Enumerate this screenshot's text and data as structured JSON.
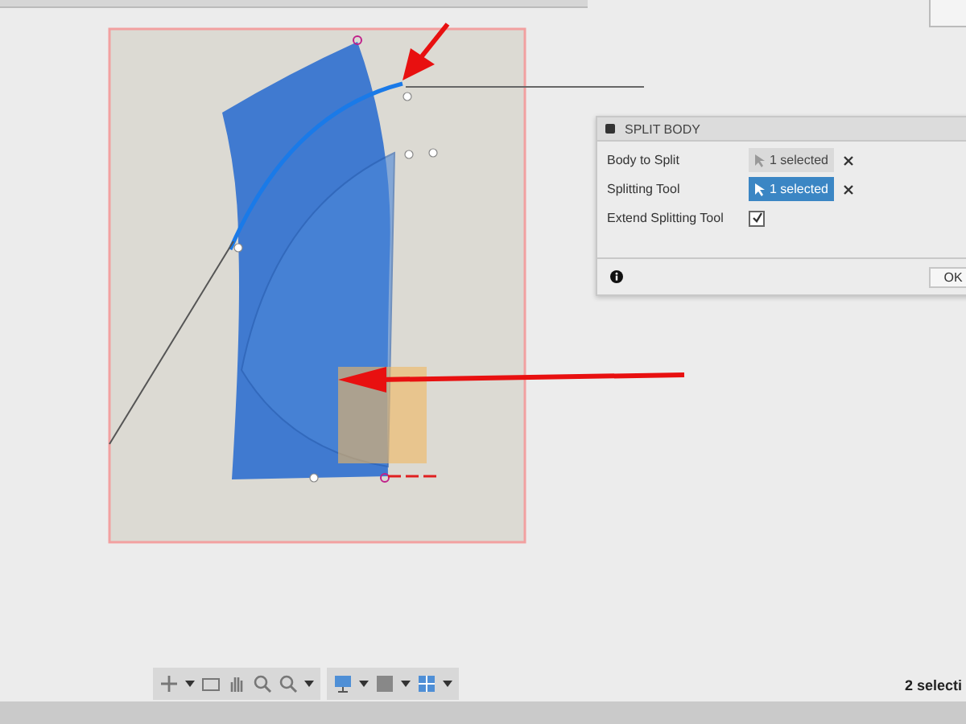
{
  "dialog": {
    "title": "SPLIT BODY",
    "rows": [
      {
        "kind": "selection",
        "label": "Body to Split",
        "value": "1 selected",
        "selected": false
      },
      {
        "kind": "selection",
        "label": "Splitting Tool",
        "value": "1 selected",
        "selected": true
      },
      {
        "kind": "checkbox",
        "label": "Extend Splitting Tool",
        "checked": true
      }
    ],
    "ok": "OK"
  },
  "status_bar": {
    "selection": "2 selecti"
  }
}
